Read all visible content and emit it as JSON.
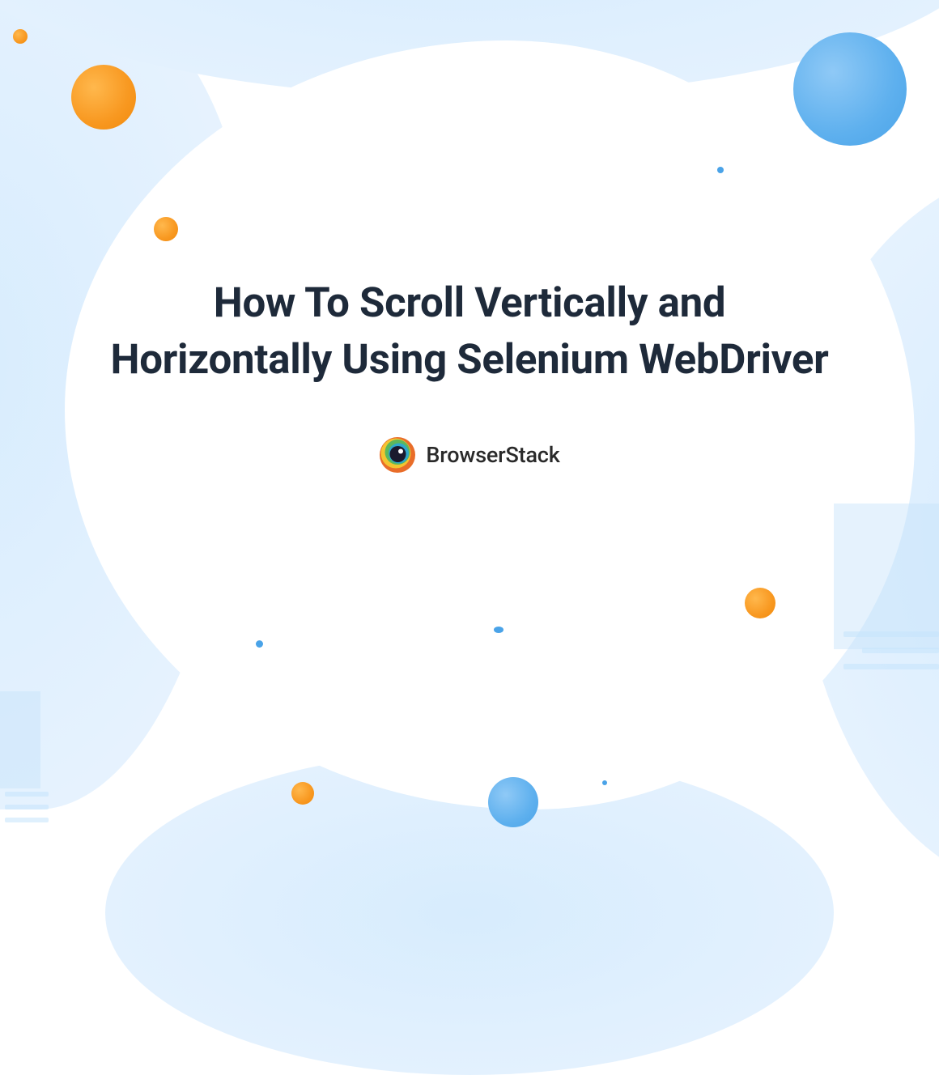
{
  "title": "How To Scroll Vertically and Horizontally Using Selenium WebDriver",
  "brand": {
    "name": "BrowserStack"
  },
  "colors": {
    "title_text": "#1e2a3a",
    "orange": "#f89820",
    "blue_accent": "#5eb0ee",
    "bg_light_blue": "#d7ecfd"
  }
}
